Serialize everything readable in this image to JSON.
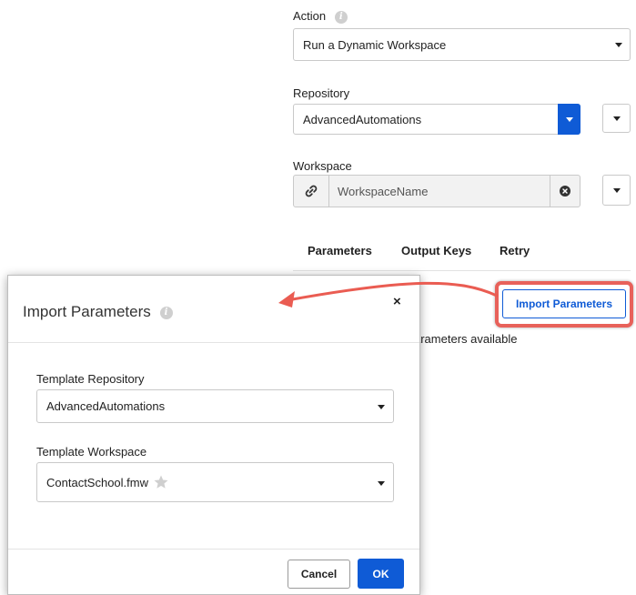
{
  "action": {
    "label": "Action",
    "selected": "Run a Dynamic Workspace"
  },
  "repository": {
    "label": "Repository",
    "selected": "AdvancedAutomations"
  },
  "workspace": {
    "label": "Workspace",
    "value": "WorkspaceName"
  },
  "tabs": [
    {
      "label": "Parameters",
      "active": true
    },
    {
      "label": "Output Keys",
      "active": false
    },
    {
      "label": "Retry",
      "active": false
    }
  ],
  "import_button_label": "Import Parameters",
  "background_message": "arameters available",
  "dialog": {
    "title": "Import Parameters",
    "close_glyph": "×",
    "template_repository": {
      "label": "Template Repository",
      "selected": "AdvancedAutomations"
    },
    "template_workspace": {
      "label": "Template Workspace",
      "selected": "ContactSchool.fmw"
    },
    "cancel_label": "Cancel",
    "ok_label": "OK"
  },
  "colors": {
    "accent_blue": "#0f5bd6",
    "highlight_red": "#e8615a",
    "arrow_red": "#ea5c52"
  }
}
